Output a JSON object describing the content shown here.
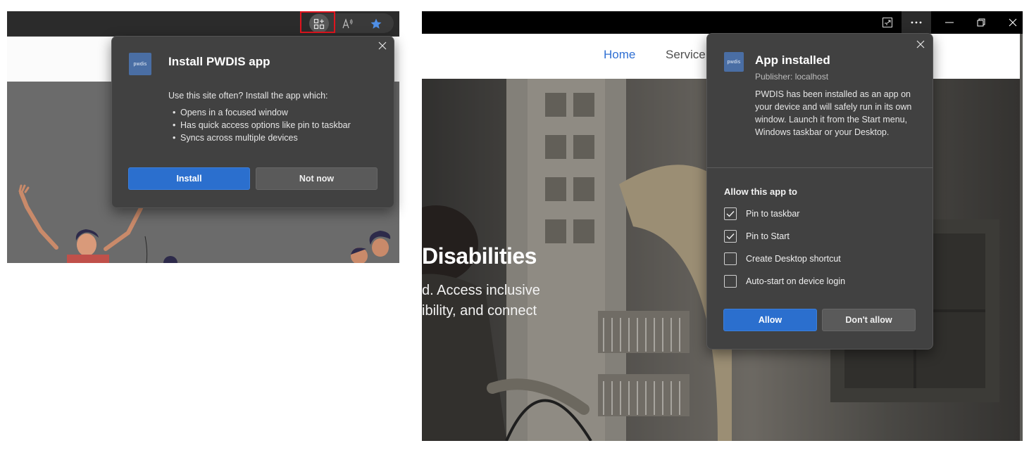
{
  "left": {
    "toolbar": {
      "app_available_icon": "app-available-icon",
      "read_aloud_icon": "read-aloud-icon",
      "favorite_icon": "star-icon"
    },
    "popup": {
      "logo_text": "pwdis",
      "title": "Install PWDIS app",
      "intro": "Use this site often? Install the app which:",
      "bullets": [
        "Opens in a focused window",
        "Has quick access options like pin to taskbar",
        "Syncs across multiple devices"
      ],
      "install_label": "Install",
      "not_now_label": "Not now"
    }
  },
  "right": {
    "titlebar": {
      "icons": [
        "app-window-icon",
        "more-icon",
        "minimize-icon",
        "restore-icon",
        "close-icon"
      ]
    },
    "nav": {
      "home": "Home",
      "services": "Service"
    },
    "hero": {
      "title": "Disabilities",
      "subtitle_line1": "d. Access inclusive",
      "subtitle_line2": "ibility, and connect"
    },
    "popup": {
      "logo_text": "pwdis",
      "title": "App installed",
      "publisher": "Publisher: localhost",
      "description": "PWDIS has been installed as an app on your device and will safely run in its own window. Launch it from the Start menu, Windows taskbar or your Desktop.",
      "allow_label": "Allow this app to",
      "options": [
        {
          "label": "Pin to taskbar",
          "checked": true
        },
        {
          "label": "Pin to Start",
          "checked": true
        },
        {
          "label": "Create Desktop shortcut",
          "checked": false
        },
        {
          "label": "Auto-start on device login",
          "checked": false
        }
      ],
      "allow_button": "Allow",
      "dont_allow_button": "Don't allow"
    }
  },
  "colors": {
    "accent": "#2b6fce",
    "popup_bg": "#414141",
    "highlight": "#e0141e"
  }
}
